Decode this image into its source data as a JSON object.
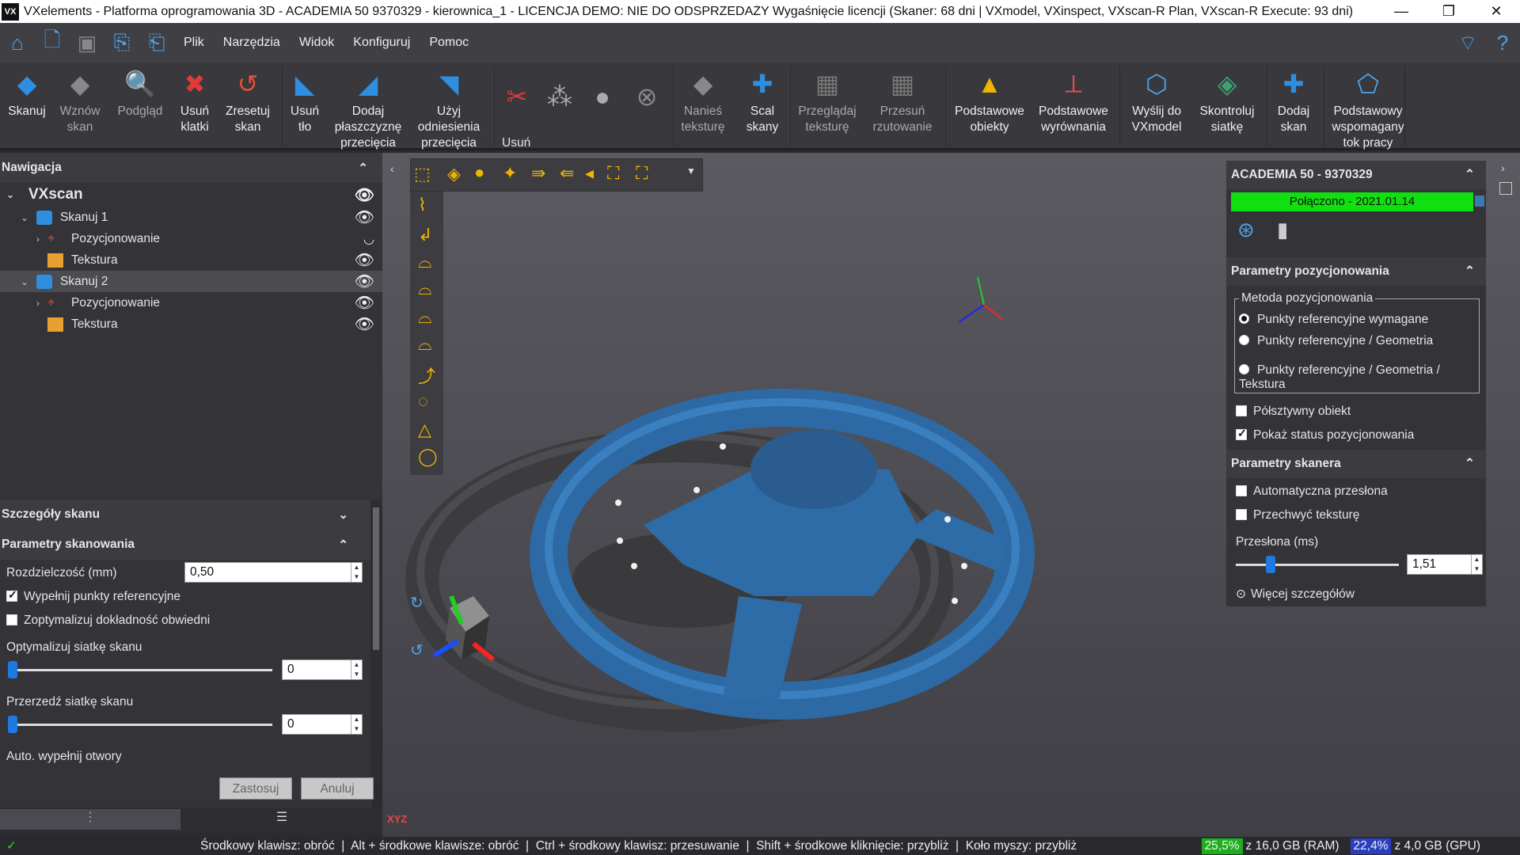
{
  "window": {
    "title": "VXelements - Platforma oprogramowania 3D - ACADEMIA 50 9370329 - kierownica_1 - LICENCJA DEMO: NIE DO ODSPRZEDAŻY Wygaśnięcie licencji (Skaner: 68 dni | VXmodel, VXinspect, VXscan-R Plan, VXscan-R Execute: 93 dni)",
    "logo": "VX",
    "minimize": "—",
    "restore": "❐",
    "close": "✕"
  },
  "menu": {
    "items": [
      "Plik",
      "Narzędzia",
      "Widok",
      "Konfiguruj",
      "Pomoc"
    ]
  },
  "ribbon": {
    "skanuj": "Skanuj",
    "wznow": "Wznów skan",
    "podglad": "Podgląd",
    "usun_klatki": "Usuń klatki",
    "zresetuj": "Zresetuj skan",
    "usun_tlo": "Usuń tło",
    "dodaj_plaszczyzne": "Dodaj płaszczyznę przecięcia",
    "uzyj_odniesienia": "Użyj odniesienia przecięcia",
    "usun_group": "Usuń",
    "nanies": "Nanieś teksturę",
    "scal": "Scal skany",
    "przegladaj": "Przeglądaj teksturę",
    "przesun": "Przesuń rzutowanie",
    "podst_obiekty": "Podstawowe obiekty",
    "podst_wyrown": "Podstawowe wyrównania",
    "wyslij": "Wyślij do VXmodel",
    "skontroluj": "Skontroluj siatkę",
    "dodaj_skan": "Dodaj skan",
    "wspomagany": "Podstawowy wspomagany tok pracy"
  },
  "navigation": {
    "title": "Nawigacja",
    "root": "VXscan",
    "tree": [
      {
        "label": "Skanuj 1",
        "level": 1
      },
      {
        "label": "Pozycjonowanie",
        "level": 2
      },
      {
        "label": "Tekstura",
        "level": 2
      },
      {
        "label": "Skanuj 2",
        "level": 1
      },
      {
        "label": "Pozycjonowanie",
        "level": 2
      },
      {
        "label": "Tekstura",
        "level": 2
      }
    ]
  },
  "details": {
    "title": "Szczegóły skanu",
    "params_title": "Parametry skanowania",
    "resolution_label": "Rozdzielczość (mm)",
    "resolution_value": "0,50",
    "fill_targets": "Wypełnij punkty referencyjne",
    "optimize_contours": "Zoptymalizuj dokładność obwiedni",
    "optimize_mesh": "Optymalizuj siatkę skanu",
    "optimize_mesh_value": "0",
    "decimate_mesh": "Przerzedź siatkę skanu",
    "decimate_mesh_value": "0",
    "auto_fill": "Auto. wypełnij otwory",
    "apply": "Zastosuj",
    "cancel": "Anuluj"
  },
  "scanner_panel": {
    "title": "ACADEMIA 50 - 9370329",
    "status": "Połączono - 2021.01.14",
    "status_color": "#10e010",
    "positioning_title": "Parametry pozycjonowania",
    "method_legend": "Metoda pozycjonowania",
    "methods": [
      "Punkty referencyjne wymagane",
      "Punkty referencyjne / Geometria",
      "Punkty referencyjne / Geometria / Tekstura"
    ],
    "semi_rigid": "Półsztywny obiekt",
    "show_status": "Pokaż status pozycjonowania",
    "scanner_title": "Parametry skanera",
    "auto_shutter": "Automatyczna przesłona",
    "capture_texture": "Przechwyć teksturę",
    "shutter_label": "Przesłona (ms)",
    "shutter_value": "1,51",
    "more": "Więcej szczegółów"
  },
  "viewport": {
    "axes_label": "XYZ"
  },
  "status": {
    "hint": "Środkowy klawisz: obróć  |  Alt + środkowe klawisze: obróć  |  Ctrl + środkowy klawisz: przesuwanie  |  Shift + środkowe kliknięcie: przybliż  |  Koło myszy: przybliż",
    "ram_pct": "25,5%",
    "ram": "z 16,0 GB (RAM)",
    "gpu_pct": "22,4%",
    "gpu": "z 4,0 GB (GPU)"
  }
}
